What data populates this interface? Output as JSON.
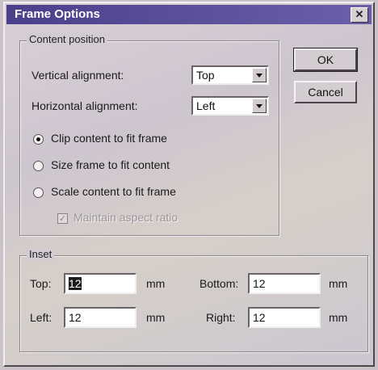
{
  "window": {
    "title": "Frame Options"
  },
  "buttons": {
    "ok": "OK",
    "cancel": "Cancel"
  },
  "content_position": {
    "legend": "Content position",
    "vertical_label": "Vertical alignment:",
    "vertical_value": "Top",
    "horizontal_label": "Horizontal alignment:",
    "horizontal_value": "Left",
    "radios": [
      {
        "label": "Clip content to fit frame",
        "selected": true
      },
      {
        "label": "Size frame to fit content",
        "selected": false
      },
      {
        "label": "Scale content to fit frame",
        "selected": false
      }
    ],
    "maintain_label": "Maintain aspect ratio",
    "maintain_checked": true
  },
  "inset": {
    "legend": "Inset",
    "top_label": "Top:",
    "top_value": "12",
    "bottom_label": "Bottom:",
    "bottom_value": "12",
    "left_label": "Left:",
    "left_value": "12",
    "right_label": "Right:",
    "right_value": "12",
    "unit": "mm"
  },
  "icons": {
    "close": "close-icon",
    "dropdown": "chevron-down-icon",
    "check": "check-icon"
  }
}
